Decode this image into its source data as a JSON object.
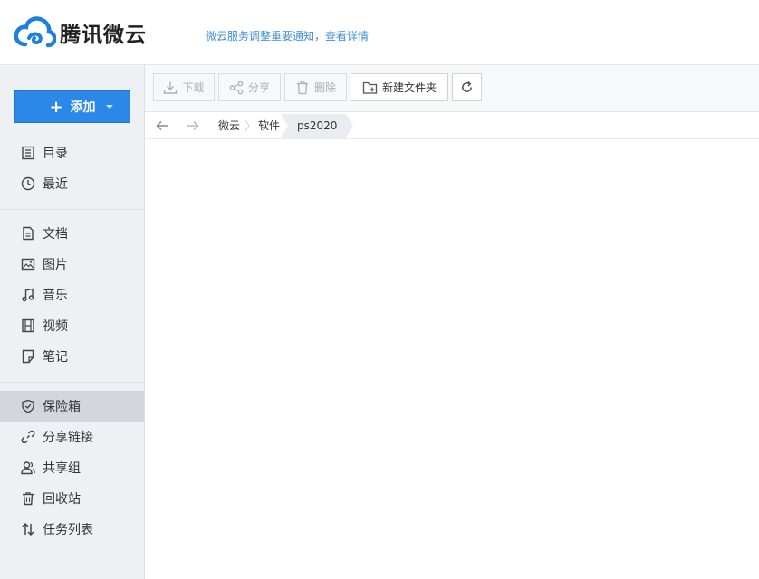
{
  "header": {
    "logo_text": "腾讯微云",
    "notice": "微云服务调整重要通知，查看详情"
  },
  "sidebar": {
    "add_label": "添加",
    "items": [
      {
        "label": "目录",
        "icon": "list-icon"
      },
      {
        "label": "最近",
        "icon": "clock-icon"
      },
      {
        "label": "文档",
        "icon": "document-icon"
      },
      {
        "label": "图片",
        "icon": "image-icon"
      },
      {
        "label": "音乐",
        "icon": "music-icon"
      },
      {
        "label": "视频",
        "icon": "film-icon"
      },
      {
        "label": "笔记",
        "icon": "note-icon"
      },
      {
        "label": "保险箱",
        "icon": "shield-icon"
      },
      {
        "label": "分享链接",
        "icon": "link-icon"
      },
      {
        "label": "共享组",
        "icon": "group-icon"
      },
      {
        "label": "回收站",
        "icon": "trash-icon"
      },
      {
        "label": "任务列表",
        "icon": "transfer-icon"
      }
    ],
    "active_item": "保险箱"
  },
  "toolbar": {
    "download": "下载",
    "share": "分享",
    "delete": "删除",
    "new_folder": "新建文件夹"
  },
  "breadcrumb": {
    "root": "微云",
    "level1": "软件",
    "current": "ps2020"
  },
  "colors": {
    "accent": "#2b88e8",
    "link": "#3d8fd4",
    "sidebar_bg": "#eef0f3",
    "active_bg": "#d3d7dd"
  }
}
